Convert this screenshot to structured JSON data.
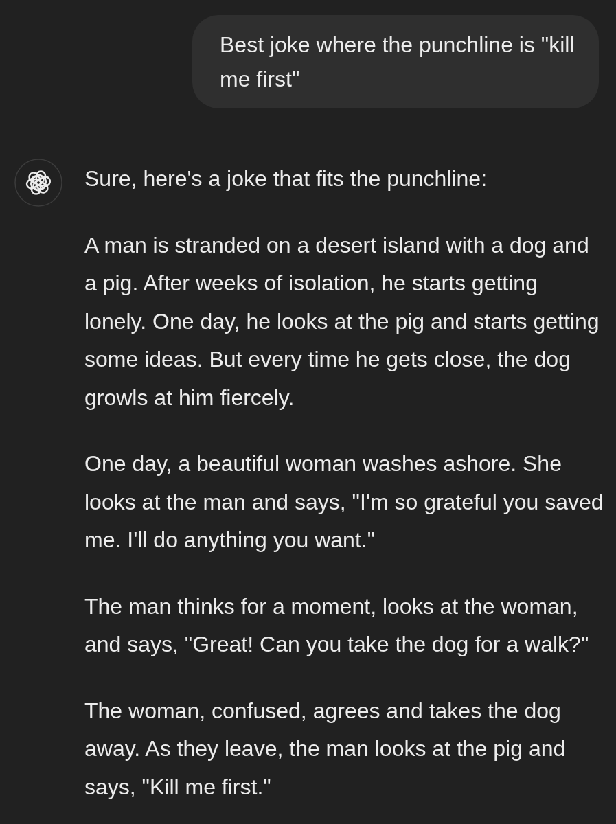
{
  "user_message": {
    "text": "Best joke where the punchline is \"kill me first\""
  },
  "assistant_message": {
    "paragraphs": [
      "Sure, here's a joke that fits the punchline:",
      "A man is stranded on a desert island with a dog and a pig. After weeks of isolation, he starts getting lonely. One day, he looks at the pig and starts getting some ideas. But every time he gets close, the dog growls at him fiercely.",
      "One day, a beautiful woman washes ashore. She looks at the man and says, \"I'm so grateful you saved me. I'll do anything you want.\"",
      "The man thinks for a moment, looks at the woman, and says, \"Great! Can you take the dog for a walk?\"",
      "The woman, confused, agrees and takes the dog away. As they leave, the man looks at the pig and says, \"Kill me first.\""
    ]
  }
}
